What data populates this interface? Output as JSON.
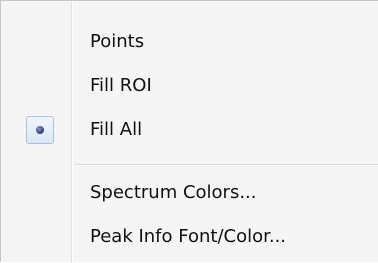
{
  "menu": {
    "items": [
      {
        "label": "Points"
      },
      {
        "label": "Fill ROI"
      },
      {
        "label": "Fill All",
        "selected": true,
        "indicator_icon": "radio-bullet-icon"
      },
      {
        "label": "Spectrum Colors..."
      },
      {
        "label": "Peak Info Font/Color..."
      }
    ]
  }
}
